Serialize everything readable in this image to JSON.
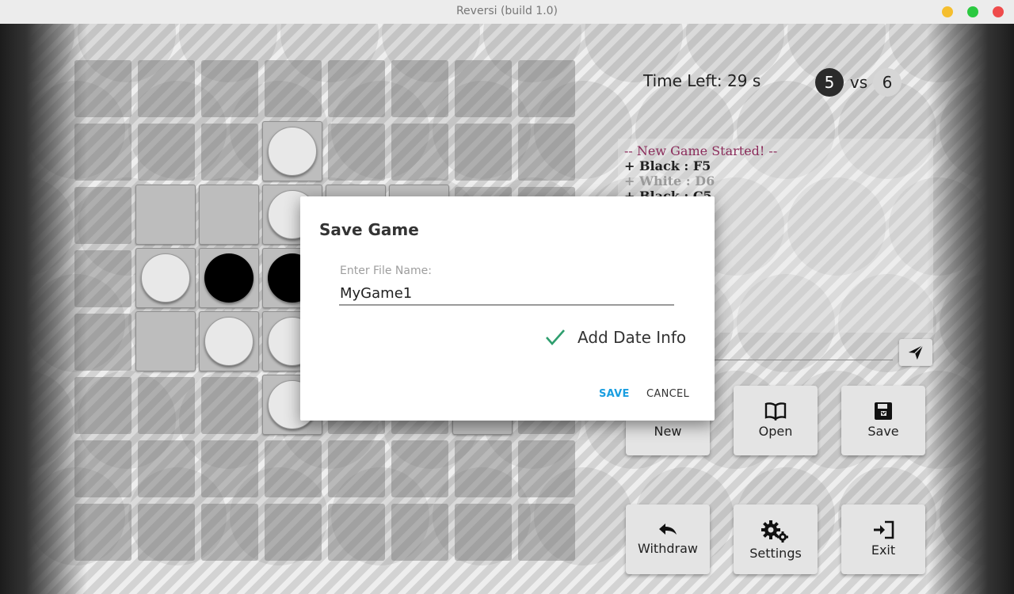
{
  "window": {
    "title": "Reversi (build 1.0)"
  },
  "status": {
    "time_left": "Time Left: 29 s",
    "black_score": "5",
    "vs": "vs",
    "white_score": "6"
  },
  "log": {
    "lines": [
      "-- New Game Started! --",
      "+ Black : F5",
      "+ White : D6",
      "+ Black : C5"
    ]
  },
  "board": {
    "cells": [
      {
        "col": "D",
        "row": 2,
        "piece": "white"
      },
      {
        "col": "B",
        "row": 3,
        "piece": "empty"
      },
      {
        "col": "C",
        "row": 3,
        "piece": "empty"
      },
      {
        "col": "D",
        "row": 3,
        "piece": "white"
      },
      {
        "col": "E",
        "row": 3,
        "piece": "empty"
      },
      {
        "col": "F",
        "row": 3,
        "piece": "empty"
      },
      {
        "col": "B",
        "row": 4,
        "piece": "white"
      },
      {
        "col": "C",
        "row": 4,
        "piece": "black"
      },
      {
        "col": "D",
        "row": 4,
        "piece": "black"
      },
      {
        "col": "B",
        "row": 5,
        "piece": "empty"
      },
      {
        "col": "C",
        "row": 5,
        "piece": "white"
      },
      {
        "col": "D",
        "row": 5,
        "piece": "white"
      },
      {
        "col": "D",
        "row": 6,
        "piece": "white"
      },
      {
        "col": "G",
        "row": 6,
        "piece": "empty"
      }
    ]
  },
  "buttons": {
    "new": {
      "label": "New",
      "icon": "new-icon"
    },
    "open": {
      "label": "Open",
      "icon": "book-icon"
    },
    "save": {
      "label": "Save",
      "icon": "floppy-disk-icon"
    },
    "withdraw": {
      "label": "Withdraw",
      "icon": "undo-arrow-icon"
    },
    "settings": {
      "label": "Settings",
      "icon": "gears-icon"
    },
    "exit": {
      "label": "Exit",
      "icon": "sign-in-icon"
    }
  },
  "dialog": {
    "title": "Save Game",
    "file_label": "Enter File Name:",
    "file_value": "MyGame1",
    "add_date_label": "Add Date Info",
    "add_date_checked": true,
    "save_label": "SAVE",
    "cancel_label": "CANCEL",
    "accent": "#1a9ee0",
    "check_color": "#2e9e6e"
  },
  "colors": {
    "log_header": "#8a2b5a",
    "black_disc": "#000000",
    "white_disc": "#e8e8e8"
  }
}
